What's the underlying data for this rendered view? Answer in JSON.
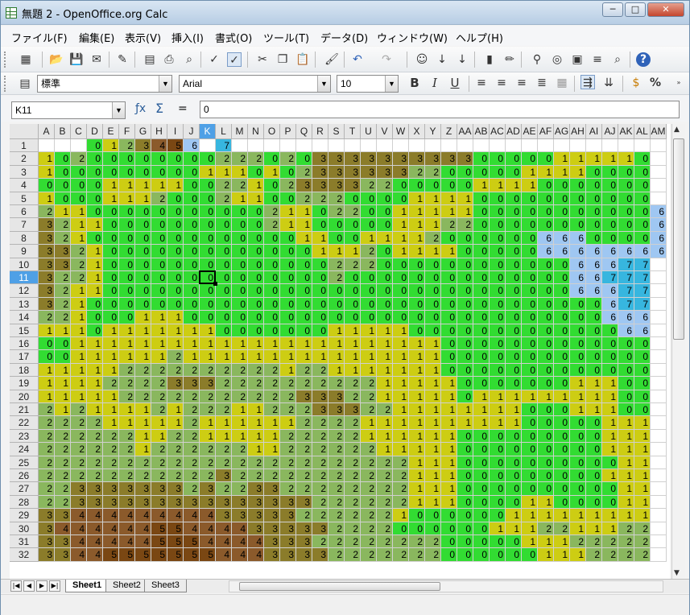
{
  "window": {
    "title": "無題 2 - OpenOffice.org Calc",
    "min_label": "─",
    "max_label": "□",
    "close_label": "✕"
  },
  "menu": [
    "ファイル(F)",
    "編集(E)",
    "表示(V)",
    "挿入(I)",
    "書式(O)",
    "ツール(T)",
    "データ(D)",
    "ウィンドウ(W)",
    "ヘルプ(H)"
  ],
  "toolbar1_icons": [
    "new-icon",
    "open-icon",
    "save-icon",
    "email-icon",
    "edit-file-icon",
    "pdf-icon",
    "print-icon",
    "print-preview-icon",
    "spellcheck-icon",
    "autospell-icon",
    "cut-icon",
    "copy-icon",
    "paste-icon",
    "format-paintbrush-icon",
    "undo-icon",
    "redo-icon",
    "hyperlink-icon",
    "sort-ascending-icon",
    "sort-descending-icon",
    "chart-icon",
    "draw-icon",
    "find-icon",
    "navigator-icon",
    "gallery-icon",
    "datasource-icon",
    "zoom-icon",
    "help-icon"
  ],
  "formatting": {
    "style": "標準",
    "font": "Arial",
    "size": "10",
    "bold": "B",
    "italic": "I",
    "underline": "U",
    "percent": "%"
  },
  "formula_bar": {
    "name_box": "K11",
    "value": "0",
    "equals": "="
  },
  "palette": {
    "0": "#32dc32",
    "1": "#cdcd13",
    "2": "#8ab75e",
    "3": "#8b7c2a",
    "4": "#8b5a2b",
    "5": "#7a4713",
    "6": "#9fc7f2",
    "7": "#37b6df"
  },
  "selection": {
    "col": "K",
    "row": 11
  },
  "columns": [
    "A",
    "B",
    "C",
    "D",
    "E",
    "F",
    "G",
    "H",
    "I",
    "J",
    "K",
    "L",
    "M",
    "N",
    "O",
    "P",
    "Q",
    "R",
    "S",
    "T",
    "U",
    "V",
    "W",
    "X",
    "Y",
    "Z",
    "AA",
    "AB",
    "AC",
    "AD",
    "AE",
    "AF",
    "AG",
    "AH",
    "AI",
    "AJ",
    "AK",
    "AL",
    "AM"
  ],
  "rows": [
    {
      "n": 1,
      "v": "---0123456 7"
    },
    {
      "n": 2,
      "v": "10200000000222020333333333300000111110"
    },
    {
      "n": 3,
      "v": "10000000001110102333333220000011110000"
    },
    {
      "n": 4,
      "v": "00001111100221023333220000011110000000"
    },
    {
      "n": 5,
      "v": "10001112000211002220000111100000000000"
    },
    {
      "n": 6,
      "v": "211000000000002110220011111000000000006"
    },
    {
      "n": 7,
      "v": "321100000000002110000011122000000000006"
    },
    {
      "n": 8,
      "v": "321000000000000011001111200000066600006"
    },
    {
      "n": 9,
      "v": "332100000000000001112011110000066666666"
    },
    {
      "n": 10,
      "v": "33210000000000000022200000000000066677"
    },
    {
      "n": 11,
      "v": "32210000000000000020000000000000066777"
    },
    {
      "n": 12,
      "v": "32110000000000000000000000000000066677"
    },
    {
      "n": 13,
      "v": "32100000000000000000000000000000000677"
    },
    {
      "n": 14,
      "v": "22100011100000000000000000000000000666"
    },
    {
      "n": 15,
      "v": "11101111111000000011111000000000000066"
    },
    {
      "n": 16,
      "v": "00111111111111111111111110000000000000"
    },
    {
      "n": 17,
      "v": "00111111211111111111111110000000000000"
    },
    {
      "n": 18,
      "v": "11111222222222212211111110000000000000"
    },
    {
      "n": 19,
      "v": "11112222333222222222211111000000011100"
    },
    {
      "n": 20,
      "v": "11111222222222223332211111011111111100"
    },
    {
      "n": 21,
      "v": "21211112122211222333221111111100011100"
    },
    {
      "n": 22,
      "v": "22221111121111112222111111111100000111"
    },
    {
      "n": 23,
      "v": "22222211221111122222111111000000000111"
    },
    {
      "n": 24,
      "v": "22222212222221122222211111000000000111"
    },
    {
      "n": 25,
      "v": "22222222222222222222222111000000000011"
    },
    {
      "n": 26,
      "v": "22222222222322222222222111000000000111"
    },
    {
      "n": 27,
      "v": "22333333323223322222222111000000000011"
    },
    {
      "n": 28,
      "v": "22333333333333333222222111000011000011"
    },
    {
      "n": 29,
      "v": "33444444444333332222221000000111111111"
    },
    {
      "n": 30,
      "v": "34444445544443333322220000001112211122"
    },
    {
      "n": 31,
      "v": "33444445554444333222222220000011122222"
    },
    {
      "n": 32,
      "v": "33445555555444333322222220000001112222"
    }
  ],
  "sheets": [
    "Sheet1",
    "Sheet2",
    "Sheet3"
  ]
}
